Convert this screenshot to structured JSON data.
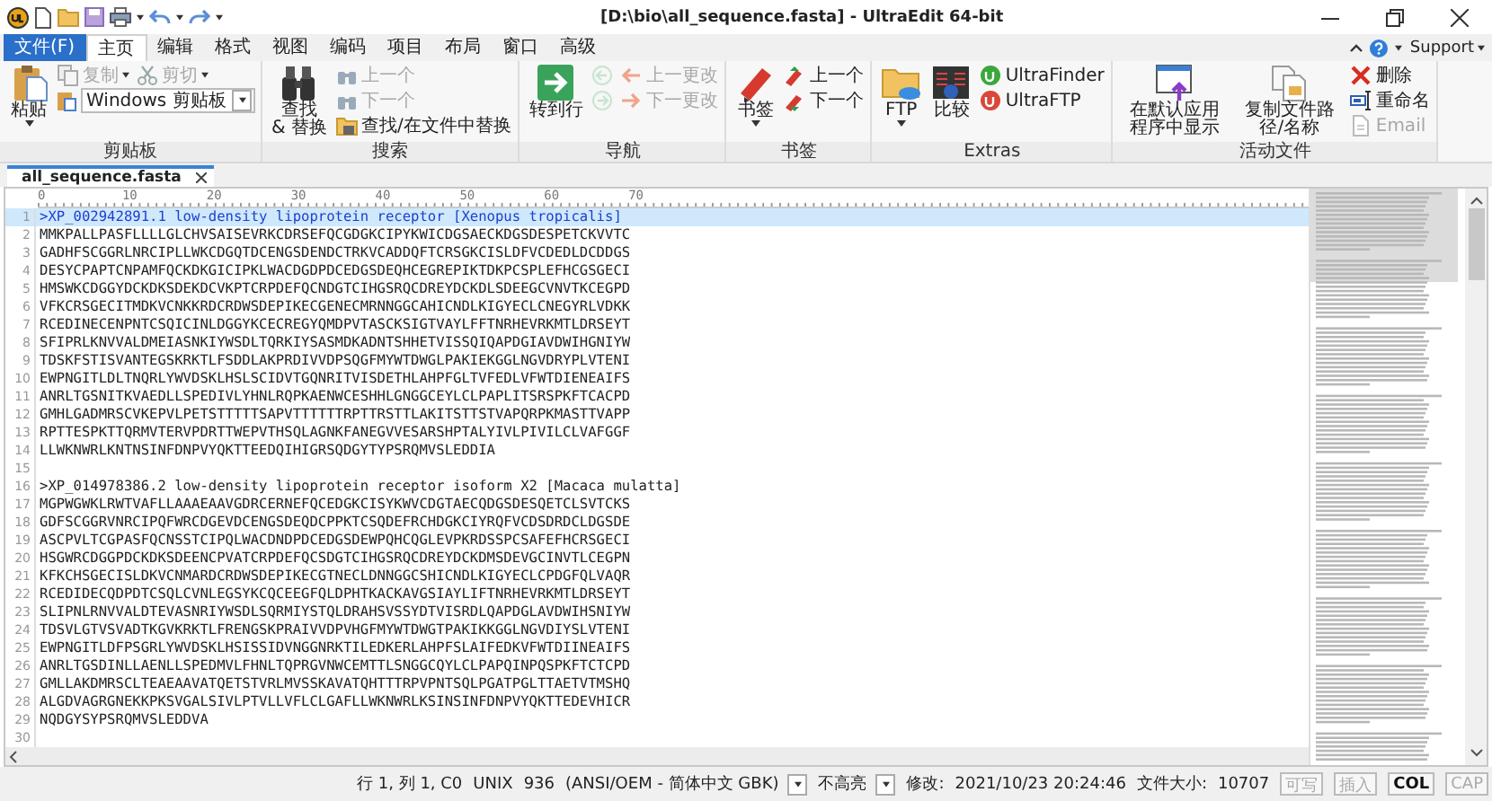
{
  "window": {
    "title": "[D:\\bio\\all_sequence.fasta] - UltraEdit 64-bit"
  },
  "menu": [
    {
      "label": "文件(F)",
      "kind": "file",
      "selected": false
    },
    {
      "label": "主页",
      "kind": "tab",
      "selected": true
    },
    {
      "label": "编辑",
      "kind": "tab",
      "selected": false
    },
    {
      "label": "格式",
      "kind": "tab",
      "selected": false
    },
    {
      "label": "视图",
      "kind": "tab",
      "selected": false
    },
    {
      "label": "编码",
      "kind": "tab",
      "selected": false
    },
    {
      "label": "项目",
      "kind": "tab",
      "selected": false
    },
    {
      "label": "布局",
      "kind": "tab",
      "selected": false
    },
    {
      "label": "窗口",
      "kind": "tab",
      "selected": false
    },
    {
      "label": "高级",
      "kind": "tab",
      "selected": false
    }
  ],
  "support": {
    "label": "Support"
  },
  "ribbon": {
    "groups": [
      {
        "label": "剪贴板",
        "columns": [
          [
            [
              {
                "kind": "large",
                "label": "粘贴",
                "caret": true,
                "disabled": false
              }
            ]
          ],
          [
            [
              {
                "kind": "small",
                "label": "复制",
                "caret": true,
                "disabled": true
              },
              {
                "kind": "small",
                "label": "剪切",
                "caret": true,
                "disabled": true
              }
            ],
            [
              {
                "kind": "combo",
                "value": "Windows 剪贴板",
                "disabled": false
              }
            ]
          ]
        ]
      },
      {
        "label": "搜索",
        "columns": [
          [
            [
              {
                "kind": "large",
                "label": "查找\n& 替换",
                "disabled": false
              }
            ]
          ],
          [
            [
              {
                "kind": "small",
                "label": "上一个",
                "disabled": true
              }
            ],
            [
              {
                "kind": "small",
                "label": "下一个",
                "disabled": true
              }
            ],
            [
              {
                "kind": "small",
                "label": "查找/在文件中替换",
                "disabled": false
              }
            ]
          ]
        ]
      },
      {
        "label": "导航",
        "columns": [
          [
            [
              {
                "kind": "large",
                "label": "转到行",
                "disabled": false
              }
            ]
          ],
          [
            [
              {
                "kind": "icon",
                "disabled": true
              }
            ],
            [
              {
                "kind": "icon",
                "disabled": true
              }
            ]
          ],
          [
            [
              {
                "kind": "small",
                "label": "上一更改",
                "disabled": true
              }
            ],
            [
              {
                "kind": "small",
                "label": "下一更改",
                "disabled": true
              }
            ]
          ]
        ]
      },
      {
        "label": "书签",
        "columns": [
          [
            [
              {
                "kind": "large",
                "label": "书签",
                "caret": true,
                "disabled": false
              }
            ]
          ],
          [
            [
              {
                "kind": "small",
                "label": "上一个",
                "disabled": false
              }
            ],
            [
              {
                "kind": "small",
                "label": "下一个",
                "disabled": false
              }
            ]
          ]
        ]
      },
      {
        "label": "Extras",
        "columns": [
          [
            [
              {
                "kind": "large",
                "label": "FTP",
                "caret": true,
                "disabled": false
              }
            ]
          ],
          [
            [
              {
                "kind": "large",
                "label": "比较",
                "disabled": false
              }
            ]
          ],
          [
            [
              {
                "kind": "small",
                "label": "UltraFinder",
                "disabled": false
              }
            ],
            [
              {
                "kind": "small",
                "label": "UltraFTP",
                "disabled": false
              }
            ]
          ]
        ]
      },
      {
        "label": "活动文件",
        "columns": [
          [
            [
              {
                "kind": "large",
                "label": "在默认应用程序中显示",
                "disabled": false
              }
            ]
          ],
          [
            [
              {
                "kind": "large",
                "label": "复制文件路径/名称",
                "disabled": false
              }
            ]
          ],
          [
            [
              {
                "kind": "small",
                "label": "删除",
                "disabled": false
              }
            ],
            [
              {
                "kind": "small",
                "label": "重命名",
                "disabled": false
              }
            ],
            [
              {
                "kind": "small",
                "label": "Email",
                "disabled": true
              }
            ]
          ]
        ]
      }
    ]
  },
  "tabs": [
    {
      "label": "all_sequence.fasta",
      "selected": true
    }
  ],
  "editor": {
    "ruler": [
      "0",
      "10",
      "20",
      "30",
      "40",
      "50",
      "60",
      "70"
    ],
    "lines": [
      {
        "number": "1",
        "text": ">XP_002942891.1 low-density lipoprotein receptor [Xenopus tropicalis]",
        "current": true
      },
      {
        "number": "2",
        "text": "MMKPALLPASFLLLLGLCHVSAISEVRKCDRSEFQCGDGKCIPYKWICDGSAECKDGSDESPETCKVVTC",
        "current": false
      },
      {
        "number": "3",
        "text": "GADHFSCGGRLNRCIPLLWKCDGQTDCENGSDENDCTRKVCADDQFTCRSGKCISLDFVCDEDLDCDDGS",
        "current": false
      },
      {
        "number": "4",
        "text": "DESYCPAPTCNPAMFQCKDKGICIPKLWACDGDPDCEDGSDEQHCEGREPIKTDKPCSPLEFHCGSGECI",
        "current": false
      },
      {
        "number": "5",
        "text": "HMSWKCDGGYDCKDKSDEKDCVKPTCRPDEFQCNDGTCIHGSRQCDREYDCKDLSDEEGCVNVTKCEGPD",
        "current": false
      },
      {
        "number": "6",
        "text": "VFKCRSGECITMDKVCNKKRDCRDWSDEPIKECGENECMRNNGGCAHICNDLKIGYECLCNEGYRLVDKK",
        "current": false
      },
      {
        "number": "7",
        "text": "RCEDINECENPNTCSQICINLDGGYKCECREGYQMDPVTASCKSIGTVAYLFFTNRHEVRKMTLDRSEYT",
        "current": false
      },
      {
        "number": "8",
        "text": "SFIPRLKNVVALDMEIASNKIYWSDLTQRKIYSASMDKADNTSHHETVISSQIQAPDGIAVDWIHGNIYW",
        "current": false
      },
      {
        "number": "9",
        "text": "TDSKFSTISVANTEGSKRKTLFSDDLAKPRDIVVDPSQGFMYWTDWGLPAKIEKGGLNGVDRYPLVTENI",
        "current": false
      },
      {
        "number": "10",
        "text": "EWPNGITLDLTNQRLYWVDSKLHSLSCIDVTGQNRITVISDETHLAHPFGLTVFEDLVFWTDIENEAIFS",
        "current": false
      },
      {
        "number": "11",
        "text": "ANRLTGSNITKVAEDLLSPEDIVLYHNLRQPKAENWCESHHLGNGGCEYLCLPAPLITSRSPKFTCACPD",
        "current": false
      },
      {
        "number": "12",
        "text": "GMHLGADMRSCVKEPVLPETSTTTTTSAPVTTTTTTRPTTRSTTLAKITSTTSTVAPQRPKMASTTVAPP",
        "current": false
      },
      {
        "number": "13",
        "text": "RPTTESPKTTQRMVTERVPDRTTWEPVTHSQLAGNKFANEGVVESARSHPTALYIVLPIVILCLVAFGGF",
        "current": false
      },
      {
        "number": "14",
        "text": "LLWKNWRLKNTNSINFDNPVYQKTTEEDQIHIGRSQDGYTYPSRQMVSLEDDIA",
        "current": false
      },
      {
        "number": "15",
        "current": false
      },
      {
        "number": "16",
        "text": ">XP_014978386.2 low-density lipoprotein receptor isoform X2 [Macaca mulatta]",
        "current": false
      },
      {
        "number": "17",
        "text": "MGPWGWKLRWTVAFLLAAAEAAVGDRCERNEFQCEDGKCISYKWVCDGTAECQDGSDESQETCLSVTCKS",
        "current": false
      },
      {
        "number": "18",
        "text": "GDFSCGGRVNRCIPQFWRCDGEVDCENGSDEQDCPPKTCSQDEFRCHDGKCIYRQFVCDSDRDCLDGSDE",
        "current": false
      },
      {
        "number": "19",
        "text": "ASCPVLTCGPASFQCNSSTCIPQLWACDNDPDCEDGSDEWPQHCQGLEVPKRDSSPCSAFEFHCRSGECI",
        "current": false
      },
      {
        "number": "20",
        "text": "HSGWRCDGGPDCKDKSDEENCPVATCRPDEFQCSDGTCIHGSRQCDREYDCKDMSDEVGCINVTLCEGPN",
        "current": false
      },
      {
        "number": "21",
        "text": "KFKCHSGECISLDKVCNMARDCRDWSDEPIKECGTNECLDNNGGCSHICNDLKIGYECLCPDGFQLVAQR",
        "current": false
      },
      {
        "number": "22",
        "text": "RCEDIDECQDPDTCSQLCVNLEGSYKCQCEEGFQLDPHTKACKAVGSIAYLIFTNRHEVRKMTLDRSEYT",
        "current": false
      },
      {
        "number": "23",
        "text": "SLIPNLRNVVALDTEVASNRIYWSDLSQRMIYSTQLDRAHSVSSYDTVISRDLQAPDGLAVDWIHSNIYW",
        "current": false
      },
      {
        "number": "24",
        "text": "TDSVLGTVSVADTKGVKRKTLFRENGSKPRAIVVDPVHGFMYWTDWGTPAKIKKGGLNGVDIYSLVTENI",
        "current": false
      },
      {
        "number": "25",
        "text": "EWPNGITLDFPSGRLYWVDSKLHSISSIDVNGGNRKTILEDKERLAHPFSLAIFEDKVFWTDIINEAIFS",
        "current": false
      },
      {
        "number": "26",
        "text": "ANRLTGSDINLLAENLLSPEDMVLFHNLTQPRGVNWCEMTTLSNGGCQYLCLPAPQINPQSPKFTCTCPD",
        "current": false
      },
      {
        "number": "27",
        "text": "GMLLAKDMRSCLTEAEAAVATQETSTVRLMVSSKAVATQHTTTRPVPNTSQLPGATPGLTTAETVTMSHQ",
        "current": false
      },
      {
        "number": "28",
        "text": "ALGDVAGRGNEKKPKSVGALSIVLPTVLLVFLCLGAFLLWKNWRLKSINSINFDNPVYQKTTEDEVHICR",
        "current": false
      },
      {
        "number": "29",
        "text": "NQDGYSYPSRQMVSLEDDVA",
        "current": false
      },
      {
        "number": "30",
        "current": false
      }
    ]
  },
  "status_bar": [
    {
      "kind": "text",
      "text": "行 1, 列 1, C0"
    },
    {
      "kind": "text",
      "text": "UNIX"
    },
    {
      "kind": "text",
      "text": "936"
    },
    {
      "kind": "dropdown",
      "text": "(ANSI/OEM - 简体中文 GBK)"
    },
    {
      "kind": "dropdown",
      "text": "不高亮"
    },
    {
      "kind": "text",
      "text": "修改:"
    },
    {
      "kind": "text",
      "text": "2021/10/23 20:24:46"
    },
    {
      "kind": "text",
      "text": "文件大小:"
    },
    {
      "kind": "text",
      "text": "10707"
    },
    {
      "kind": "toggle",
      "text": "可写",
      "on": false
    },
    {
      "kind": "toggle",
      "text": "插入",
      "on": false
    },
    {
      "kind": "toggle",
      "text": "COL",
      "on": true
    },
    {
      "kind": "toggle",
      "text": "CAP",
      "on": false
    }
  ]
}
